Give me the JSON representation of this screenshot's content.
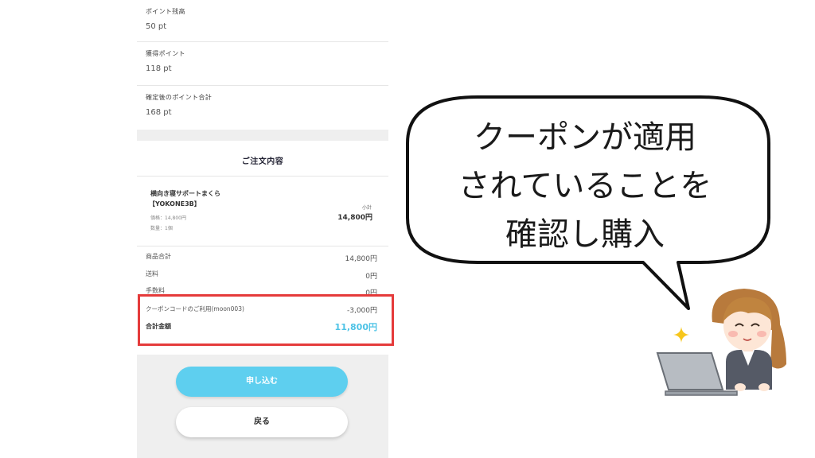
{
  "points": {
    "balance": {
      "label": "ポイント残高",
      "value": "50 pt"
    },
    "earned": {
      "label": "獲得ポイント",
      "value": "118 pt"
    },
    "total_after": {
      "label": "確定後のポイント合計",
      "value": "168 pt"
    }
  },
  "order": {
    "title": "ご注文内容",
    "product": {
      "name": "横向き寝サポートまくら",
      "code": "【YOKONE3B】",
      "price": "価格：14,800円",
      "quantity": "数量：1個",
      "subtotal_label": "小計",
      "subtotal_value": "14,800円"
    },
    "summary": {
      "goods_total_label": "商品合計",
      "goods_total_value": "14,800円",
      "shipping_label": "送料",
      "shipping_value": "0円",
      "fee_label": "手数料",
      "fee_value": "0円",
      "coupon_label": "クーポンコードのご利用(moon003)",
      "coupon_value": "-3,000円",
      "total_label": "合計金額",
      "total_value": "11,800円"
    }
  },
  "buttons": {
    "apply": "申し込む",
    "back": "戻る"
  },
  "callout": {
    "line1": "クーポンが適用",
    "line2": "されていることを",
    "line3": "確認し購入"
  },
  "colors": {
    "accent": "#5ecfef",
    "highlight_border": "#e53b3b",
    "total_price": "#4ec3e6"
  },
  "icons": [
    "sparkle-icon",
    "laptop-icon",
    "woman-illustration"
  ]
}
